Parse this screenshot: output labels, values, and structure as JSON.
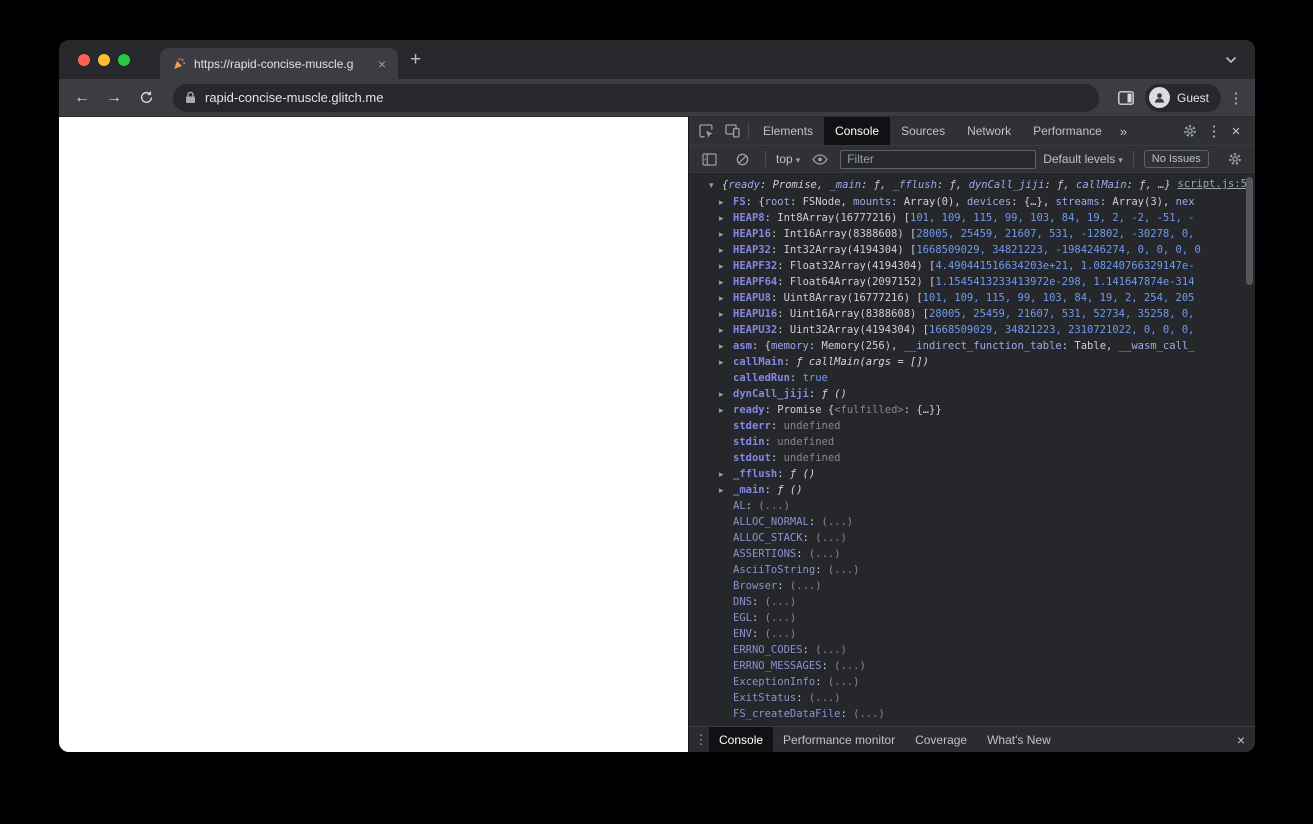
{
  "icons": {
    "back": "←",
    "forward": "→",
    "new_tab": "+",
    "tab_close": "×",
    "menu_kebab": "⋮",
    "chevron_down": "▾",
    "more_tabs": "»",
    "devtools_close": "×",
    "drawer_kebab": "⋮",
    "drawer_close": "×",
    "expanded": "▾",
    "collapsed": "▸"
  },
  "window": {
    "tab_title": "https://rapid-concise-muscle.g",
    "address": "rapid-concise-muscle.glitch.me",
    "profile_label": "Guest"
  },
  "devtools": {
    "tabs": [
      "Elements",
      "Console",
      "Sources",
      "Network",
      "Performance"
    ],
    "selected_tab": "Console",
    "toolbar": {
      "context_selector": "top",
      "filter_placeholder": "Filter",
      "levels_label": "Default levels",
      "issues_label": "No Issues"
    },
    "drawer": {
      "tabs": [
        "Console",
        "Performance monitor",
        "Coverage",
        "What's New"
      ],
      "selected_tab": "Console"
    },
    "console": {
      "source_link": "script.js:5",
      "preview": [
        [
          "g",
          "{"
        ],
        [
          "k",
          "ready"
        ],
        [
          "g",
          ": Promise, "
        ],
        [
          "k",
          "_main"
        ],
        [
          "g",
          ": ƒ, "
        ],
        [
          "k",
          "_fflush"
        ],
        [
          "g",
          ": ƒ, "
        ],
        [
          "k",
          "dynCall_jiji"
        ],
        [
          "g",
          ": ƒ, "
        ],
        [
          "k",
          "callMain"
        ],
        [
          "g",
          ": ƒ, …}"
        ]
      ],
      "rows": [
        {
          "a": 1,
          "n": "FS",
          "v": [
            [
              "g",
              "{"
            ],
            [
              "k",
              "root"
            ],
            [
              "g",
              ": FSNode, "
            ],
            [
              "k",
              "mounts"
            ],
            [
              "g",
              ": Array(0), "
            ],
            [
              "k",
              "devices"
            ],
            [
              "g",
              ": {…}, "
            ],
            [
              "k",
              "streams"
            ],
            [
              "g",
              ": Array(3), "
            ],
            [
              "k",
              "nex"
            ]
          ]
        },
        {
          "a": 1,
          "n": "HEAP8",
          "v": [
            [
              "g",
              "Int8Array(16777216) ["
            ],
            [
              "n",
              "101, 109, 115, 99, 103, 84, 19, 2, -2, -51, -"
            ]
          ]
        },
        {
          "a": 1,
          "n": "HEAP16",
          "v": [
            [
              "g",
              "Int16Array(8388608) ["
            ],
            [
              "n",
              "28005, 25459, 21607, 531, -12802, -30278, 0,"
            ]
          ]
        },
        {
          "a": 1,
          "n": "HEAP32",
          "v": [
            [
              "g",
              "Int32Array(4194304) ["
            ],
            [
              "n",
              "1668509029, 34821223, -1984246274, 0, 0, 0, 0"
            ]
          ]
        },
        {
          "a": 1,
          "n": "HEAPF32",
          "v": [
            [
              "g",
              "Float32Array(4194304) ["
            ],
            [
              "n",
              "4.490441516634203e+21, 1.08240766329147e-"
            ]
          ]
        },
        {
          "a": 1,
          "n": "HEAPF64",
          "v": [
            [
              "g",
              "Float64Array(2097152) ["
            ],
            [
              "n",
              "1.1545413233413972e-298, 1.141647874e-314"
            ]
          ]
        },
        {
          "a": 1,
          "n": "HEAPU8",
          "v": [
            [
              "g",
              "Uint8Array(16777216) ["
            ],
            [
              "n",
              "101, 109, 115, 99, 103, 84, 19, 2, 254, 205"
            ]
          ]
        },
        {
          "a": 1,
          "n": "HEAPU16",
          "v": [
            [
              "g",
              "Uint16Array(8388608) ["
            ],
            [
              "n",
              "28005, 25459, 21607, 531, 52734, 35258, 0,"
            ]
          ]
        },
        {
          "a": 1,
          "n": "HEAPU32",
          "v": [
            [
              "g",
              "Uint32Array(4194304) ["
            ],
            [
              "n",
              "1668509029, 34821223, 2310721022, 0, 0, 0,"
            ]
          ]
        },
        {
          "a": 1,
          "n": "asm",
          "v": [
            [
              "g",
              "{"
            ],
            [
              "k",
              "memory"
            ],
            [
              "g",
              ": Memory(256), "
            ],
            [
              "k",
              "__indirect_function_table"
            ],
            [
              "g",
              ": Table, "
            ],
            [
              "k",
              "__wasm_call_"
            ]
          ]
        },
        {
          "a": 1,
          "n": "callMain",
          "v": [
            [
              "i",
              "ƒ callMain(args = [])"
            ]
          ]
        },
        {
          "a": 0,
          "n": "calledRun",
          "v": [
            [
              "b",
              "true"
            ]
          ]
        },
        {
          "a": 1,
          "n": "dynCall_jiji",
          "v": [
            [
              "i",
              "ƒ ()"
            ]
          ]
        },
        {
          "a": 1,
          "n": "ready",
          "v": [
            [
              "g",
              "Promise {"
            ],
            [
              "u",
              "<fulfilled>"
            ],
            [
              "g",
              ": {…}}"
            ]
          ]
        },
        {
          "a": 0,
          "n": "stderr",
          "v": [
            [
              "u",
              "undefined"
            ]
          ]
        },
        {
          "a": 0,
          "n": "stdin",
          "v": [
            [
              "u",
              "undefined"
            ]
          ]
        },
        {
          "a": 0,
          "n": "stdout",
          "v": [
            [
              "u",
              "undefined"
            ]
          ]
        },
        {
          "a": 1,
          "n": "_fflush",
          "v": [
            [
              "i",
              "ƒ ()"
            ]
          ]
        },
        {
          "a": 1,
          "n": "_main",
          "v": [
            [
              "i",
              "ƒ ()"
            ]
          ]
        },
        {
          "a": 0,
          "d": 1,
          "n": "AL",
          "v": [
            [
              "u",
              "(...)"
            ]
          ]
        },
        {
          "a": 0,
          "d": 1,
          "n": "ALLOC_NORMAL",
          "v": [
            [
              "u",
              "(...)"
            ]
          ]
        },
        {
          "a": 0,
          "d": 1,
          "n": "ALLOC_STACK",
          "v": [
            [
              "u",
              "(...)"
            ]
          ]
        },
        {
          "a": 0,
          "d": 1,
          "n": "ASSERTIONS",
          "v": [
            [
              "u",
              "(...)"
            ]
          ]
        },
        {
          "a": 0,
          "d": 1,
          "n": "AsciiToString",
          "v": [
            [
              "u",
              "(...)"
            ]
          ]
        },
        {
          "a": 0,
          "d": 1,
          "n": "Browser",
          "v": [
            [
              "u",
              "(...)"
            ]
          ]
        },
        {
          "a": 0,
          "d": 1,
          "n": "DNS",
          "v": [
            [
              "u",
              "(...)"
            ]
          ]
        },
        {
          "a": 0,
          "d": 1,
          "n": "EGL",
          "v": [
            [
              "u",
              "(...)"
            ]
          ]
        },
        {
          "a": 0,
          "d": 1,
          "n": "ENV",
          "v": [
            [
              "u",
              "(...)"
            ]
          ]
        },
        {
          "a": 0,
          "d": 1,
          "n": "ERRNO_CODES",
          "v": [
            [
              "u",
              "(...)"
            ]
          ]
        },
        {
          "a": 0,
          "d": 1,
          "n": "ERRNO_MESSAGES",
          "v": [
            [
              "u",
              "(...)"
            ]
          ]
        },
        {
          "a": 0,
          "d": 1,
          "n": "ExceptionInfo",
          "v": [
            [
              "u",
              "(...)"
            ]
          ]
        },
        {
          "a": 0,
          "d": 1,
          "n": "ExitStatus",
          "v": [
            [
              "u",
              "(...)"
            ]
          ]
        },
        {
          "a": 0,
          "d": 1,
          "n": "FS_createDataFile",
          "v": [
            [
              "u",
              "(...)"
            ]
          ]
        }
      ]
    }
  }
}
